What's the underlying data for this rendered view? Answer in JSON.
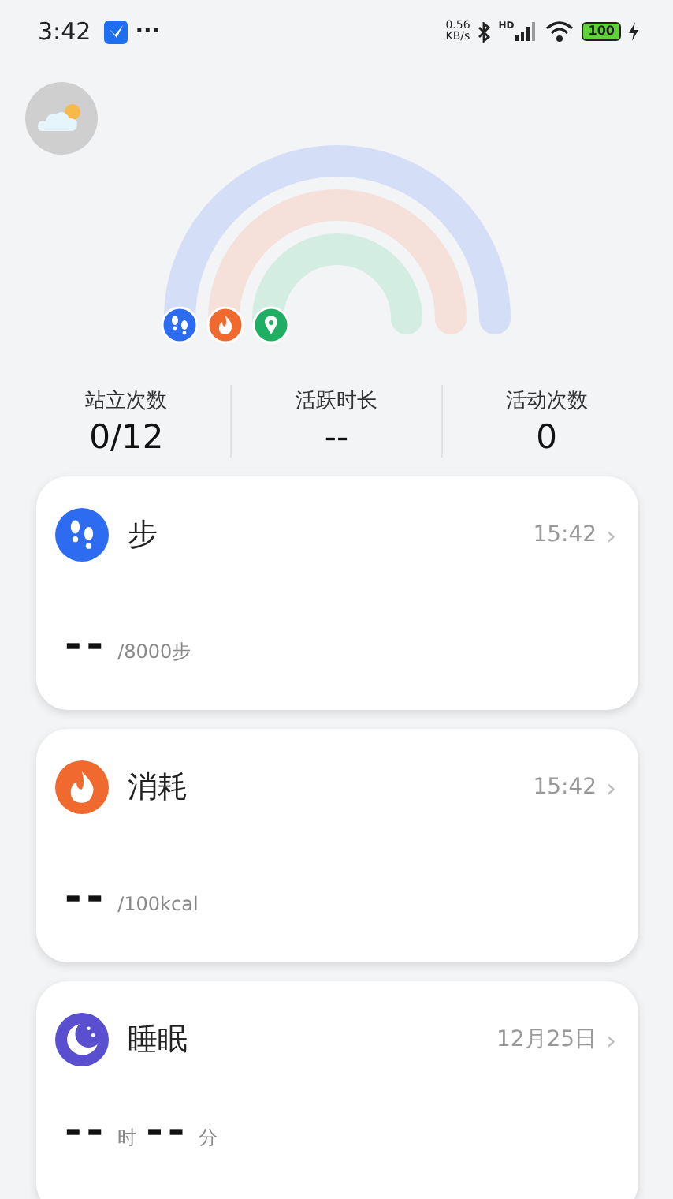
{
  "status_bar": {
    "time": "3:42",
    "more": "···",
    "speed": "0.56",
    "speed_unit": "KB/s",
    "signal_label": "HD",
    "battery": "100"
  },
  "stats": [
    {
      "label": "站立次数",
      "value": "0/12"
    },
    {
      "label": "活跃时长",
      "value": "--"
    },
    {
      "label": "活动次数",
      "value": "0"
    }
  ],
  "cards": [
    {
      "kind": "steps",
      "title": "步",
      "time": "15:42",
      "arrow": "›",
      "values": [
        {
          "value": "--",
          "unit": "/8000步"
        }
      ]
    },
    {
      "kind": "calories",
      "title": "消耗",
      "time": "15:42",
      "arrow": "›",
      "values": [
        {
          "value": "--",
          "unit": "/100kcal"
        }
      ]
    },
    {
      "kind": "sleep",
      "title": "睡眠",
      "time": "12月25日",
      "arrow": "›",
      "values": [
        {
          "value": "--",
          "unit": "时"
        },
        {
          "value": "--",
          "unit": "分"
        }
      ]
    }
  ]
}
